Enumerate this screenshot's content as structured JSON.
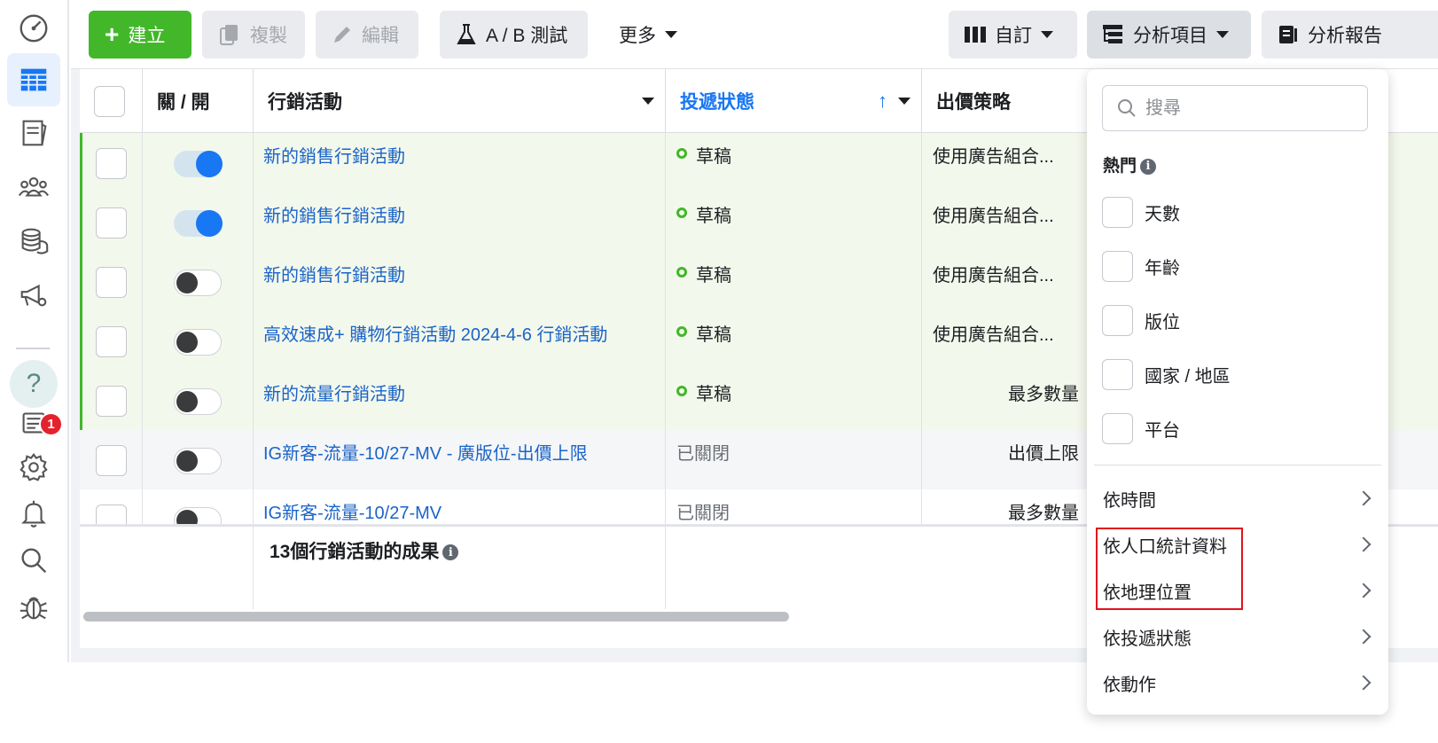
{
  "toolbar": {
    "create_label": "建立",
    "duplicate_label": "複製",
    "edit_label": "編輯",
    "ab_test_label": "A / B 測試",
    "more_label": "更多",
    "customize_label": "自訂",
    "breakdown_label": "分析項目",
    "reports_label": "分析報告"
  },
  "table": {
    "headers": {
      "on_off": "關 / 開",
      "campaign": "行銷活動",
      "delivery": "投遞狀態",
      "bid_strategy": "出價策略"
    },
    "rows": [
      {
        "name": "新的銷售行銷活動",
        "status": "草稿",
        "bid": "使用廣告組合...",
        "toggle_on": true,
        "state": "draft"
      },
      {
        "name": "新的銷售行銷活動",
        "status": "草稿",
        "bid": "使用廣告組合...",
        "toggle_on": true,
        "state": "draft"
      },
      {
        "name": "新的銷售行銷活動",
        "status": "草稿",
        "bid": "使用廣告組合...",
        "toggle_on": false,
        "state": "draft"
      },
      {
        "name": "高效速成+ 購物行銷活動 2024-4-6 行銷活動",
        "status": "草稿",
        "bid": "使用廣告組合...",
        "toggle_on": false,
        "state": "draft"
      },
      {
        "name": "新的流量行銷活動",
        "status": "草稿",
        "bid": "最多數量",
        "toggle_on": false,
        "state": "draft"
      },
      {
        "name": "IG新客-流量-10/27-MV - 廣版位-出價上限",
        "status": "已關閉",
        "bid": "出價上限",
        "toggle_on": false,
        "state": "closed"
      },
      {
        "name": "IG新客-流量-10/27-MV",
        "status": "已關閉",
        "bid": "最多數量",
        "toggle_on": false,
        "state": "closed"
      }
    ],
    "footer_summary": "13個行銷活動的成果"
  },
  "rail": {
    "notification_count": "1",
    "help_glyph": "?"
  },
  "breakdown_menu": {
    "search_placeholder": "搜尋",
    "popular_heading": "熱門",
    "popular_options": [
      "天數",
      "年齡",
      "版位",
      "國家 / 地區",
      "平台"
    ],
    "submenus": [
      "依時間",
      "依人口統計資料",
      "依地理位置",
      "依投遞狀態",
      "依動作"
    ],
    "highlighted": [
      "依人口統計資料",
      "依地理位置"
    ]
  },
  "colors": {
    "accent": "#1877f2",
    "create_green": "#42b72a",
    "highlight_red": "#e3111e",
    "badge_red": "#e4222e"
  }
}
